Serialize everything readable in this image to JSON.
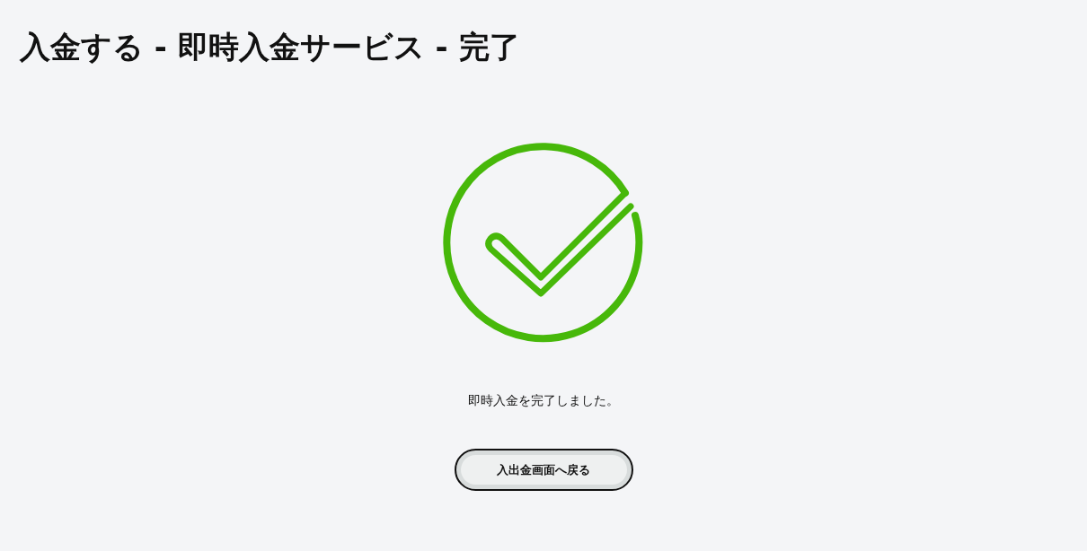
{
  "page_title": "入金する - 即時入金サービス - 完了",
  "message": "即時入金を完了しました。",
  "back_button": {
    "label": "入出金画面へ戻る"
  }
}
